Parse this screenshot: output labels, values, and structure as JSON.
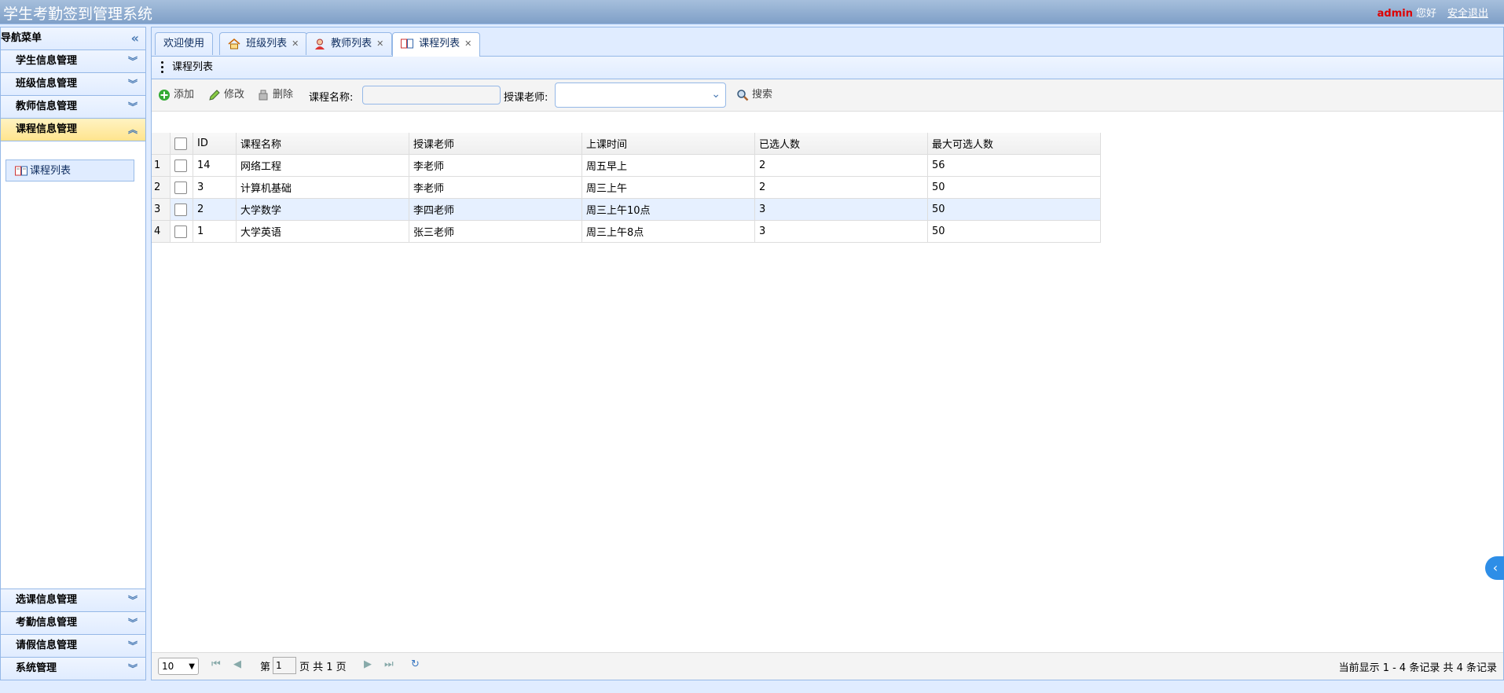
{
  "header": {
    "title": "学生考勤签到管理系统",
    "user": "admin",
    "greeting": "您好",
    "logout": "安全退出"
  },
  "sidebar": {
    "title": "导航菜单",
    "sections": [
      {
        "label": "学生信息管理"
      },
      {
        "label": "班级信息管理"
      },
      {
        "label": "教师信息管理"
      },
      {
        "label": "课程信息管理"
      }
    ],
    "active_sub": "课程列表",
    "bottom_sections": [
      {
        "label": "选课信息管理"
      },
      {
        "label": "考勤信息管理"
      },
      {
        "label": "请假信息管理"
      },
      {
        "label": "系统管理"
      }
    ]
  },
  "tabs": [
    {
      "label": "欢迎使用"
    },
    {
      "label": "班级列表"
    },
    {
      "label": "教师列表"
    },
    {
      "label": "课程列表"
    }
  ],
  "content": {
    "title": "课程列表",
    "toolbar": {
      "add": "添加",
      "edit": "修改",
      "delete": "删除",
      "course_name_label": "课程名称:",
      "teacher_label": "授课老师:",
      "search": "搜索"
    },
    "columns": [
      "ID",
      "课程名称",
      "授课老师",
      "上课时间",
      "已选人数",
      "最大可选人数"
    ],
    "rows": [
      {
        "rn": "1",
        "id": "14",
        "name": "网络工程",
        "teacher": "李老师",
        "time": "周五早上",
        "selected": "2",
        "max": "56"
      },
      {
        "rn": "2",
        "id": "3",
        "name": "计算机基础",
        "teacher": "李老师",
        "time": "周三上午",
        "selected": "2",
        "max": "50"
      },
      {
        "rn": "3",
        "id": "2",
        "name": "大学数学",
        "teacher": "李四老师",
        "time": "周三上午10点",
        "selected": "3",
        "max": "50"
      },
      {
        "rn": "4",
        "id": "1",
        "name": "大学英语",
        "teacher": "张三老师",
        "time": "周三上午8点",
        "selected": "3",
        "max": "50"
      }
    ]
  },
  "pager": {
    "page_size": "10",
    "page_prefix": "第",
    "page": "1",
    "page_suffix": "页 共 1 页",
    "info": "当前显示 1 - 4 条记录 共 4 条记录"
  },
  "colors": {
    "header": "#7f9fc7",
    "active_section": "#ffe48d",
    "border": "#95b8e7",
    "brand_red": "#dd0000"
  }
}
